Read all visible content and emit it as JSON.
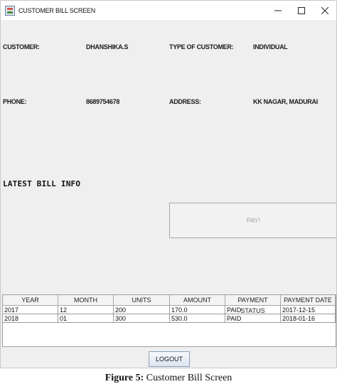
{
  "window": {
    "title": "CUSTOMER BILL SCREEN"
  },
  "customer": {
    "customer_label": "CUSTOMER:",
    "customer_value": "DHANSHIKA.S",
    "type_label": "TYPE OF CUSTOMER:",
    "type_value": "INDIVIDUAL",
    "phone_label": "PHONE:",
    "phone_value": "8689754678",
    "address_label": "ADDRESS:",
    "address_value": "KK NAGAR, MADURAI"
  },
  "bill": {
    "heading": "LATEST BILL INFO",
    "pay_label": "PAY!"
  },
  "table": {
    "columns": [
      "YEAR",
      "MONTH",
      "UNITS",
      "AMOUNT",
      "PAYMENT STATUS",
      "PAYMENT DATE"
    ],
    "rows": [
      [
        "2017",
        "12",
        "200",
        "170.0",
        "PAID",
        "2017-12-15"
      ],
      [
        "2018",
        "01",
        "300",
        "530.0",
        "PAID",
        "2018-01-16"
      ]
    ]
  },
  "footer": {
    "logout_label": "LOGOUT"
  },
  "caption": {
    "label": "Figure 5:",
    "text": "Customer Bill Screen"
  },
  "colors": {
    "window_bg": "#efefef",
    "pay_text": "#a2a2a2",
    "logout_border": "#8aa0b8"
  }
}
